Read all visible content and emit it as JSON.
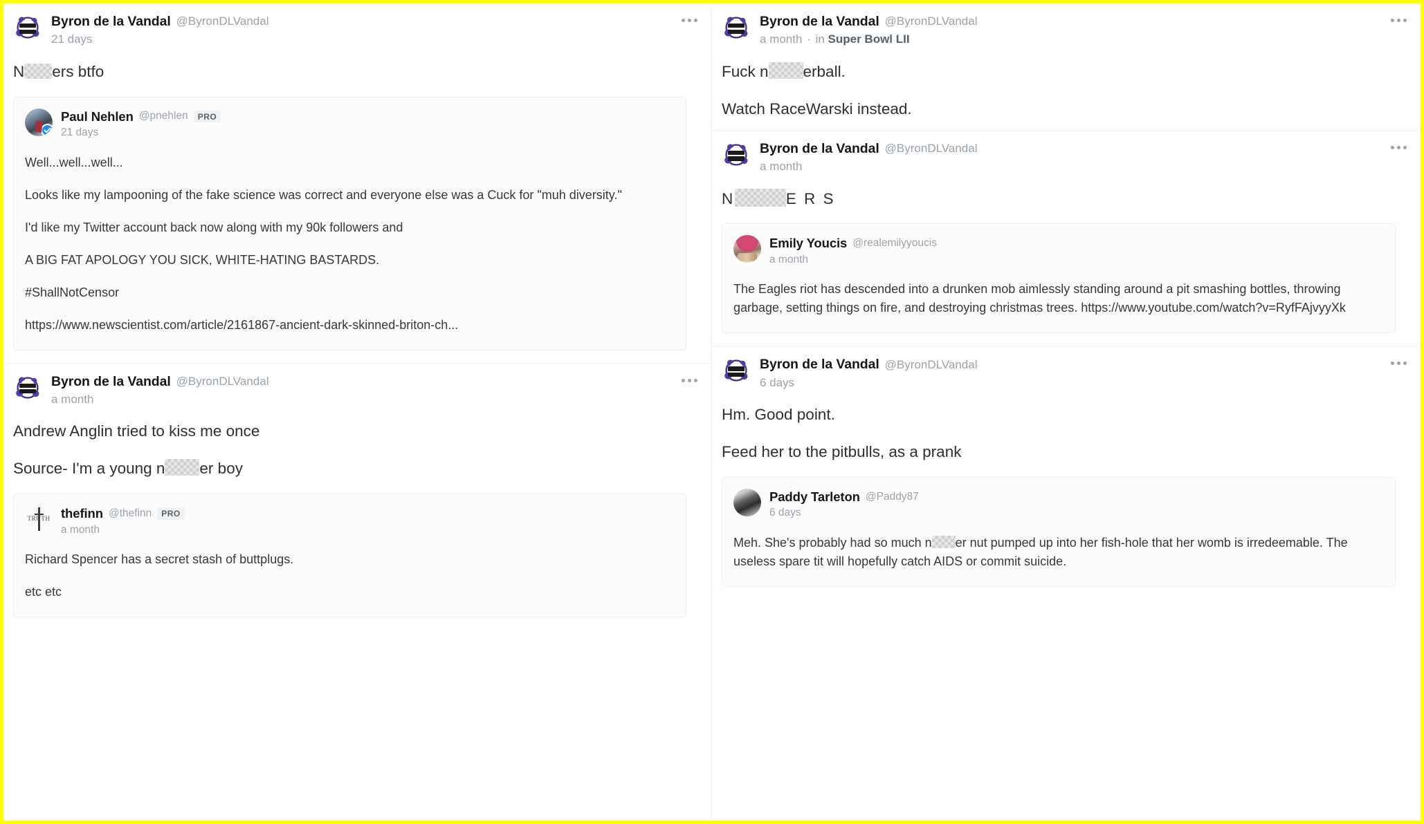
{
  "theme": {
    "highlight_border": "#ffff00",
    "accent_verified": "#1d8df0",
    "text_primary": "#2b2f33",
    "text_muted": "#9aa2ab",
    "card_bg": "#fcfcfd",
    "card_border": "#eceef0"
  },
  "icons": {
    "more": "more-horizontal-icon",
    "verified": "verified-check-icon"
  },
  "badges": {
    "pro": "PRO"
  },
  "columns": [
    {
      "id": "left-column",
      "posts": [
        {
          "id": "post-niggers-btfo",
          "author": {
            "name": "Byron de la Vandal",
            "handle": "@ByronDLVandal",
            "avatar": "byron-avatar",
            "verified": false,
            "pro": false
          },
          "timestamp": "21 days",
          "group": null,
          "body": [
            {
              "type": "redacted",
              "before": "N",
              "after": "ers btfo",
              "width": "w-small"
            }
          ],
          "quote": {
            "id": "quote-paul-nehlen",
            "author": {
              "name": "Paul Nehlen",
              "handle": "@pnehlen",
              "avatar": "nehlen-avatar",
              "verified": true,
              "pro": true
            },
            "timestamp": "21 days",
            "body": [
              {
                "type": "text",
                "text": "Well...well...well..."
              },
              {
                "type": "text",
                "text": "Looks like my lampooning of the fake science was correct and everyone else was a Cuck for \"muh diversity.\""
              },
              {
                "type": "text",
                "text": "I'd like my Twitter account back now along with my 90k followers and"
              },
              {
                "type": "text",
                "text": "A BIG FAT APOLOGY YOU SICK, WHITE-HATING BASTARDS."
              },
              {
                "type": "text",
                "text": "#ShallNotCensor"
              },
              {
                "type": "text",
                "text": "https://www.newscientist.com/article/2161867-ancient-dark-skinned-briton-ch..."
              }
            ]
          }
        },
        {
          "id": "post-andrew-anglin",
          "author": {
            "name": "Byron de la Vandal",
            "handle": "@ByronDLVandal",
            "avatar": "byron-avatar",
            "verified": false,
            "pro": false
          },
          "timestamp": "a month",
          "group": null,
          "body": [
            {
              "type": "text",
              "text": "Andrew Anglin tried to kiss me once"
            },
            {
              "type": "redacted",
              "before": "Source- I'm a young n",
              "after": "er boy",
              "width": "w-mid"
            }
          ],
          "quote": {
            "id": "quote-thefinn",
            "author": {
              "name": "thefinn",
              "handle": "@thefinn",
              "avatar": "finn-avatar",
              "verified": false,
              "pro": true
            },
            "timestamp": "a month",
            "body": [
              {
                "type": "text",
                "text": "Richard Spencer has a secret stash of buttplugs."
              },
              {
                "type": "text",
                "text": "etc etc"
              }
            ]
          }
        }
      ]
    },
    {
      "id": "right-column",
      "posts": [
        {
          "id": "post-super-bowl",
          "author": {
            "name": "Byron de la Vandal",
            "handle": "@ByronDLVandal",
            "avatar": "byron-avatar",
            "verified": false,
            "pro": false
          },
          "timestamp": "a month",
          "group": {
            "prefix": "in",
            "name": "Super Bowl LII"
          },
          "body": [
            {
              "type": "redacted",
              "before": "Fuck n",
              "after": "erball.",
              "width": "w-mid"
            },
            {
              "type": "text",
              "text": "Watch RaceWarski instead."
            }
          ],
          "quote": null
        },
        {
          "id": "post-caps-slur",
          "author": {
            "name": "Byron de la Vandal",
            "handle": "@ByronDLVandal",
            "avatar": "byron-avatar",
            "verified": false,
            "pro": false
          },
          "timestamp": "a month",
          "group": null,
          "body": [
            {
              "type": "redacted",
              "before": "N",
              "after": "E R S",
              "width": "w-caps",
              "spaced": true
            }
          ],
          "quote": {
            "id": "quote-emily-youcis",
            "author": {
              "name": "Emily Youcis",
              "handle": "@realemilyyoucis",
              "avatar": "emily-avatar",
              "verified": false,
              "pro": false
            },
            "timestamp": "a month",
            "body": [
              {
                "type": "text",
                "text": "The Eagles riot has descended into a drunken mob aimlessly standing around a pit smashing bottles, throwing garbage, setting things on fire, and destroying christmas trees. https://www.youtube.com/watch?v=RyfFAjvyyXk"
              }
            ]
          }
        },
        {
          "id": "post-good-point",
          "author": {
            "name": "Byron de la Vandal",
            "handle": "@ByronDLVandal",
            "avatar": "byron-avatar",
            "verified": false,
            "pro": false
          },
          "timestamp": "6 days",
          "group": null,
          "body": [
            {
              "type": "text",
              "text": "Hm. Good point."
            },
            {
              "type": "text",
              "text": "Feed her to the pitbulls, as a prank"
            }
          ],
          "quote": {
            "id": "quote-paddy-tarleton",
            "author": {
              "name": "Paddy Tarleton",
              "handle": "@Paddy87",
              "avatar": "paddy-avatar",
              "verified": false,
              "pro": false
            },
            "timestamp": "6 days",
            "body": [
              {
                "type": "redacted",
                "before": "Meh.  She's probably had so much n",
                "after": "er nut pumped up into her fish-hole that her womb is irredeemable.  The useless spare tit will hopefully catch AIDS or commit suicide.",
                "width": "w-small"
              }
            ]
          }
        }
      ]
    }
  ]
}
